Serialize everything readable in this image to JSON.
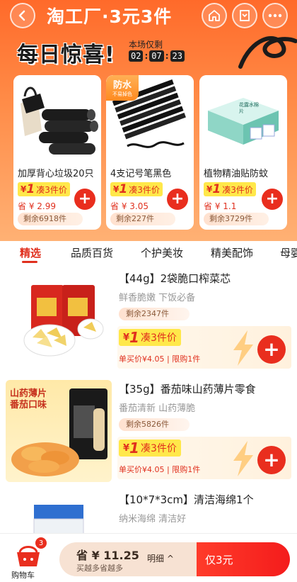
{
  "nav": {
    "title": "淘工厂·3元3件"
  },
  "banner": {
    "big_title": "每日惊喜!",
    "deadline_label": "本场仅剩",
    "timer": {
      "h": "02",
      "m": "07",
      "s": "23"
    }
  },
  "featured": [
    {
      "name": "加厚背心垃圾20只",
      "currency": "¥",
      "price": "1",
      "deal": "凑3件价",
      "saved": "省 ¥ 2.99",
      "remaining": "剩余6918件"
    },
    {
      "name": "4支记号笔黑色",
      "currency": "¥",
      "price": "1",
      "deal": "凑3件价",
      "saved": "省 ¥ 3.05",
      "remaining": "剩余227件",
      "badge_main": "防水",
      "badge_sub": "不易掉色"
    },
    {
      "name": "植物精油贴防蚊",
      "currency": "¥",
      "price": "1",
      "deal": "凑3件价",
      "saved": "省 ¥ 1.1",
      "remaining": "剩余3729件",
      "box_text": "花露水棉片"
    }
  ],
  "tabs": [
    "精选",
    "品质百货",
    "个护美妆",
    "精美配饰",
    "母婴"
  ],
  "products": [
    {
      "title": "【44g】2袋脆口榨菜芯",
      "subtitle": "鲜香脆嫩 下饭必备",
      "remaining": "剩余2347件",
      "currency": "¥",
      "price": "1",
      "deal": "凑3件价",
      "single": "单买价¥4.05 | 限购1件"
    },
    {
      "title": "【35g】番茄味山药薄片零食",
      "subtitle": "番茄清新 山药薄脆",
      "remaining": "剩余5826件",
      "currency": "¥",
      "price": "1",
      "deal": "凑3件价",
      "single": "单买价¥4.05 | 限购1件",
      "img_text": "山药薄片番茄口味"
    },
    {
      "title": "【10*7*3cm】清洁海绵1个",
      "subtitle": "纳米海绵 清洁好"
    }
  ],
  "bottom": {
    "cart_label": "购物车",
    "cart_count": "3",
    "save_amount": "省 ¥ 11.25",
    "save_hint": "买越多省越多",
    "detail_label": "明细 ^",
    "buy_label": "仅3元"
  },
  "colors": {
    "accent": "#e92e1e",
    "header": "#ff6a2a",
    "pricetag": "#ffe84a"
  }
}
